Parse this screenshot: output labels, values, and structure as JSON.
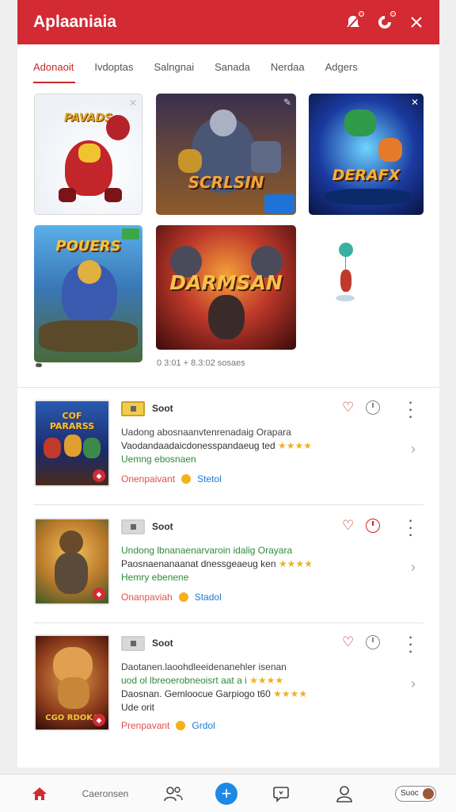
{
  "app": {
    "title": "Aplaaniaia"
  },
  "tabs": [
    "Adonaoit",
    "Ivdoptas",
    "Salngnai",
    "Sanada",
    "Nerdaa",
    "Adgers"
  ],
  "tiles": [
    {
      "title": "PAVADS"
    },
    {
      "title": "SCRLSIN"
    },
    {
      "title": "DERAFX"
    },
    {
      "title": "POUERS"
    },
    {
      "title": "DARMSAN"
    }
  ],
  "tiles_caption": "0 3:01 + 8.3:02 sosaes",
  "items": [
    {
      "tag": "Soot",
      "thumb_title": "COF PARARSS",
      "line1": "Uadong abosnaanvtenrenadaig Orapara",
      "line2": "Vaodandaadaicdonesspandaeug ted",
      "line3": "Uemng ebosnaen",
      "stars": "★★★★",
      "meta_left": "Onenpaivant",
      "meta_right": "Stetol"
    },
    {
      "tag": "Soot",
      "thumb_title": "",
      "line1": "Undong lbnanaenarvaroin idalig Orayara",
      "line2": "Paosnaenanaanat dnessgeaeug ken",
      "line3": "Hemry ebenene",
      "stars": "★★★★",
      "meta_left": "Onanpaviah",
      "meta_right": "Stadol"
    },
    {
      "tag": "Soot",
      "thumb_title": "CGO RDOKA",
      "line1": "Daotanen.laoohdleeidenanehler isenan",
      "line2": "uod ol      lbreoerobneoisrt aat a i",
      "line3": "Daosnan. Gemloocue Garpiogo t60",
      "line4": "Ude orit",
      "stars": "★★★★",
      "meta_left": "Prenpavant",
      "meta_right": "Grdol"
    }
  ],
  "nav": {
    "home_label": "Home",
    "center_label": "Caeronsen",
    "pill_label": "Suoc"
  },
  "colors": {
    "brand_red": "#d32a33",
    "accent_blue": "#1e88e5",
    "star_gold": "#f2b01e",
    "link_green": "#2e8b3a"
  }
}
